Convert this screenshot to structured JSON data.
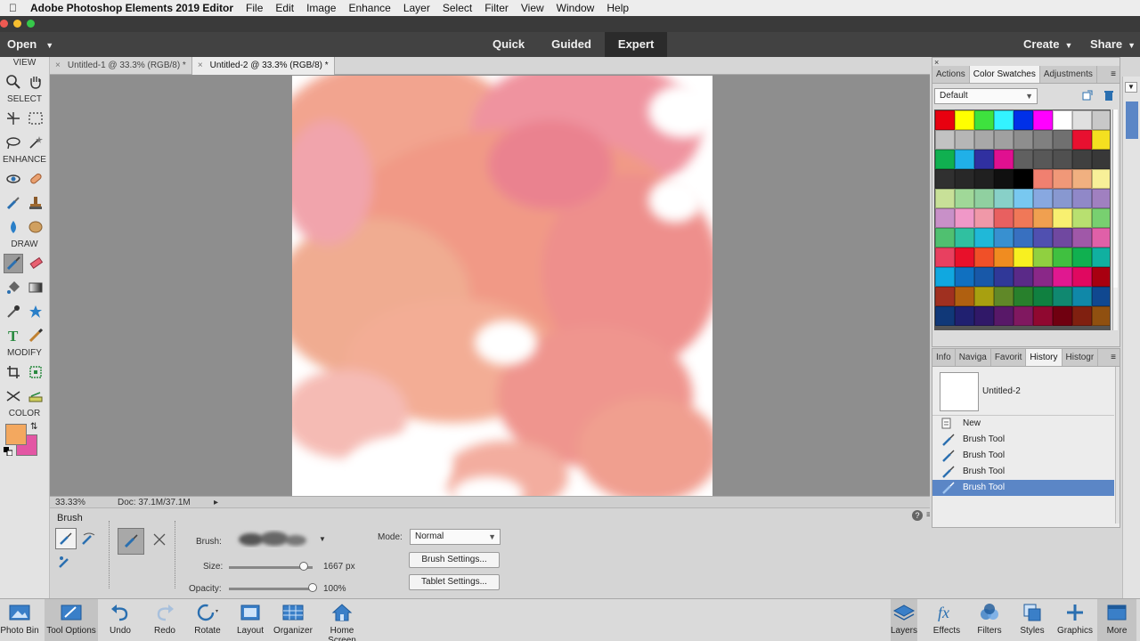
{
  "menubar": {
    "app_name": "Adobe Photoshop Elements 2019 Editor",
    "items": [
      "File",
      "Edit",
      "Image",
      "Enhance",
      "Layer",
      "Select",
      "Filter",
      "View",
      "Window",
      "Help"
    ]
  },
  "appbar": {
    "open_label": "Open",
    "modes": [
      "Quick",
      "Guided",
      "Expert"
    ],
    "active_mode": "Expert",
    "create_label": "Create",
    "share_label": "Share"
  },
  "toolbox": {
    "sections": [
      "VIEW",
      "SELECT",
      "ENHANCE",
      "DRAW",
      "MODIFY",
      "COLOR"
    ],
    "foreground_color": "#f3a85f",
    "background_color": "#e356a4"
  },
  "document": {
    "tabs": [
      {
        "label": "Untitled-1 @ 33.3% (RGB/8) *",
        "active": false
      },
      {
        "label": "Untitled-2 @ 33.3% (RGB/8) *",
        "active": true
      }
    ],
    "zoom": "33.33%",
    "doc_info": "Doc: 37.1M/37.1M"
  },
  "tool_options": {
    "title": "Brush",
    "brush_label": "Brush:",
    "size_label": "Size:",
    "size_value": "1667 px",
    "size_fraction": 0.89,
    "opacity_label": "Opacity:",
    "opacity_value": "100%",
    "opacity_fraction": 1.0,
    "mode_label": "Mode:",
    "mode_value": "Normal",
    "brush_settings": "Brush Settings...",
    "tablet_settings": "Tablet Settings..."
  },
  "swatch_panel": {
    "tabs": [
      "Actions",
      "Color Swatches",
      "Adjustments"
    ],
    "active_tab": "Color Swatches",
    "preset": "Default",
    "swatches": [
      "#e8000f",
      "#ffff00",
      "#3ee23e",
      "#33f3ff",
      "#0030e8",
      "#ff00ff",
      "#ffffff",
      "#e0e0e0",
      "#c8c8c8",
      "#c2c2c2",
      "#b6b6b6",
      "#a8a8a8",
      "#a0a0a0",
      "#8e8e8e",
      "#808080",
      "#707070",
      "#e81030",
      "#f4e020",
      "#10b050",
      "#20b0e8",
      "#3030a0",
      "#e01090",
      "#606060",
      "#585858",
      "#505050",
      "#404040",
      "#383838",
      "#303030",
      "#282828",
      "#202020",
      "#101010",
      "#000000",
      "#f08070",
      "#f09878",
      "#f0b080",
      "#f8f098",
      "#c8e098",
      "#a0d898",
      "#90d0a0",
      "#88d0c8",
      "#78c8f0",
      "#88a8e0",
      "#8898d0",
      "#9088c8",
      "#a080c0",
      "#c890c8",
      "#f098c8",
      "#f098a8",
      "#e86060",
      "#f07858",
      "#f0a050",
      "#f8f070",
      "#b8e070",
      "#78d070",
      "#50c070",
      "#30c0a0",
      "#20b8d8",
      "#3890d0",
      "#3870c0",
      "#5050b0",
      "#7048a0",
      "#a058a8",
      "#e060a8",
      "#e84060",
      "#e8102a",
      "#f05028",
      "#f08c20",
      "#f8f020",
      "#90d040",
      "#40c040",
      "#10b050",
      "#10b0a0",
      "#10a8e0",
      "#1070c0",
      "#1858a8",
      "#303898",
      "#5a2a88",
      "#8a2888",
      "#e01890",
      "#e00860",
      "#a80010",
      "#a03020",
      "#b06010",
      "#a8a010",
      "#608828",
      "#28802c",
      "#108040",
      "#108870",
      "#1088a8",
      "#104890",
      "#103878",
      "#202070",
      "#301868",
      "#581868",
      "#801860",
      "#900830",
      "#700010",
      "#802010",
      "#905010"
    ]
  },
  "history_panel": {
    "tabs": [
      "Info",
      "Naviga",
      "Favorit",
      "History",
      "Histogr"
    ],
    "active_tab": "History",
    "snapshot_label": "Untitled-2",
    "items": [
      "New",
      "Brush Tool",
      "Brush Tool",
      "Brush Tool",
      "Brush Tool"
    ],
    "selected_index": 4
  },
  "bottombar": {
    "left": [
      "Photo Bin",
      "Tool Options",
      "Undo",
      "Redo",
      "Rotate",
      "Layout",
      "Organizer",
      "Home Screen"
    ],
    "right": [
      "Layers",
      "Effects",
      "Filters",
      "Styles",
      "Graphics",
      "More"
    ]
  },
  "colors": {
    "accent_blue": "#5b86c6",
    "paint_pink": "#ef8e8c",
    "paint_orange": "#f4a98a"
  }
}
